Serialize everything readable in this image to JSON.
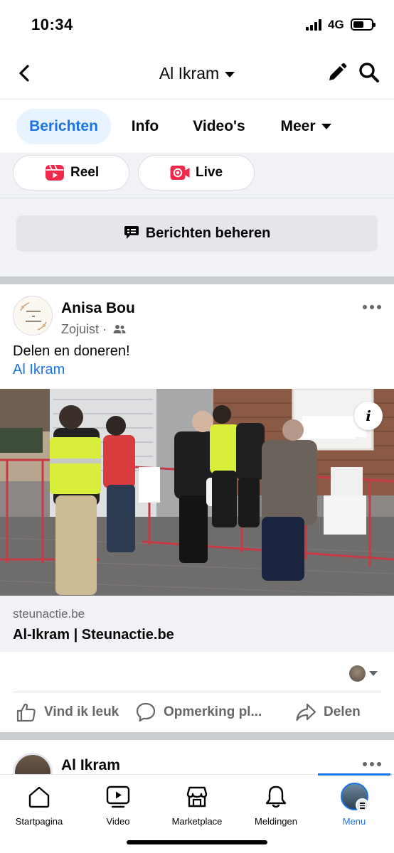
{
  "status_bar": {
    "time": "10:34",
    "network": "4G",
    "battery_level": 0.6
  },
  "header": {
    "title": "Al Ikram",
    "icons": [
      "back-icon",
      "chevron-down-icon",
      "edit-icon",
      "search-icon"
    ]
  },
  "tabs": [
    {
      "label": "Berichten",
      "active": true
    },
    {
      "label": "Info"
    },
    {
      "label": "Video's"
    },
    {
      "label": "Meer"
    }
  ],
  "create_chips": {
    "reel_label": "Reel",
    "live_label": "Live",
    "reel_color": "#f02849",
    "live_color": "#f02849"
  },
  "manage_button": {
    "label": "Berichten beheren"
  },
  "post": {
    "author": "Anisa Bou",
    "time": "Zojuist",
    "audience_icon": "friends-icon",
    "text": "Delen en doneren!",
    "link_text": "Al Ikram",
    "link_card": {
      "domain": "steunactie.be",
      "title": "Al-Ikram | Steunactie.be"
    },
    "actions": {
      "like": "Vind ik leuk",
      "comment": "Opmerking pl...",
      "share": "Delen"
    }
  },
  "next_post": {
    "author": "Al Ikram"
  },
  "bottom_nav": [
    {
      "label": "Startpagina",
      "icon": "home-icon"
    },
    {
      "label": "Video",
      "icon": "video-icon"
    },
    {
      "label": "Marketplace",
      "icon": "marketplace-icon"
    },
    {
      "label": "Meldingen",
      "icon": "bell-icon"
    },
    {
      "label": "Menu",
      "icon": "profile-menu-icon",
      "active": true
    }
  ],
  "colors": {
    "accent": "#1b74e4",
    "secondary_text": "#65676b",
    "background_grey": "#f0f2f5"
  }
}
